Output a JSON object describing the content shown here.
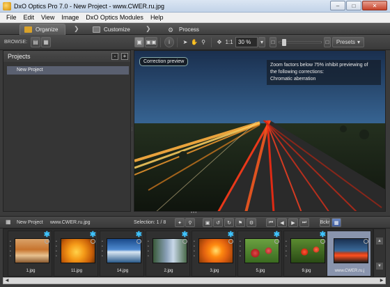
{
  "window": {
    "title": "DxO Optics Pro 7.0 - New Project - www.CWER.ru.jpg"
  },
  "menu": [
    "File",
    "Edit",
    "View",
    "Image",
    "DxO Optics Modules",
    "Help"
  ],
  "tabs": {
    "organize": "Organize",
    "customize": "Customize",
    "process": "Process"
  },
  "toolbar": {
    "browse_label": "BROWSE:",
    "zoom_value": "30 %",
    "one_to_one": "1:1",
    "presets": "Presets"
  },
  "projects": {
    "title": "Projects",
    "add": "+",
    "remove": "-",
    "items": [
      "New Project"
    ]
  },
  "preview": {
    "badge": "Correction preview",
    "note_line1": "Zoom factors below 75% inhibit previewing of",
    "note_line2": "the following corrections:",
    "note_line3": "Chromatic aberration"
  },
  "strip_bar": {
    "project": "New Project",
    "file": "www.CWER.ru.jpg",
    "selection": "Selection: 1 / 8",
    "bw": "Bckr"
  },
  "thumbnails": [
    {
      "name": "1.jpg"
    },
    {
      "name": "11.jpg"
    },
    {
      "name": "14.jpg"
    },
    {
      "name": "2.jpg"
    },
    {
      "name": "3.jpg"
    },
    {
      "name": "5.jpg"
    },
    {
      "name": "9.jpg"
    },
    {
      "name": "www.CWER.ru.j"
    }
  ]
}
